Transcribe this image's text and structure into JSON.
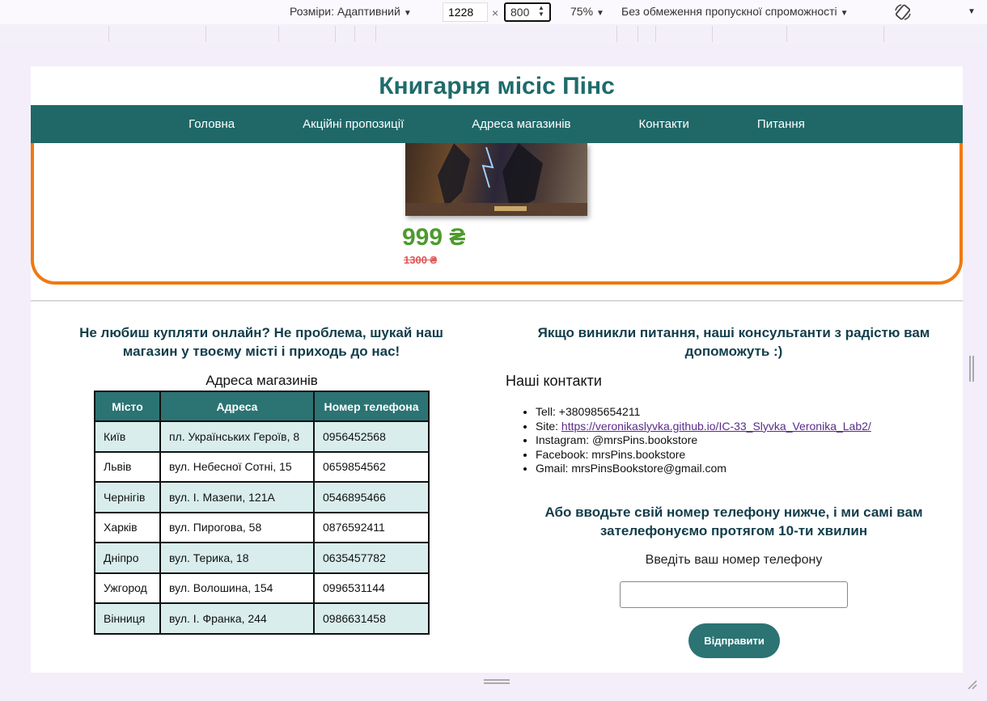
{
  "devtools": {
    "size_label": "Розміри: Адаптивний",
    "width": "1228",
    "height": "800",
    "times": "×",
    "zoom": "75%",
    "throttle": "Без обмеження пропускної спроможності"
  },
  "site": {
    "title": "Книгарня місіс Пінс",
    "nav": [
      "Головна",
      "Акційні пропозиції",
      "Адреса магазинів",
      "Контакти",
      "Питання"
    ]
  },
  "promo": {
    "price_new": "999 ₴",
    "price_old": "1300 ₴"
  },
  "stores": {
    "heading": "Не любиш купляти онлайн? Не проблема, шукай наш магазин у твоєму місті і приходь до нас!",
    "caption": "Адреса магазинів",
    "columns": [
      "Місто",
      "Адреса",
      "Номер телефона"
    ],
    "rows": [
      [
        "Київ",
        "пл. Українських Героїв, 8",
        "0956452568"
      ],
      [
        "Львів",
        "вул. Небесної Сотні, 15",
        "0659854562"
      ],
      [
        "Чернігів",
        "вул. І. Мазепи, 121А",
        "0546895466"
      ],
      [
        "Харків",
        "вул. Пирогова, 58",
        "0876592411"
      ],
      [
        "Дніпро",
        "вул. Терика, 18",
        "0635457782"
      ],
      [
        "Ужгород",
        "вул. Волошина, 154",
        "0996531144"
      ],
      [
        "Вінниця",
        "вул. І. Франка, 244",
        "0986631458"
      ]
    ]
  },
  "contacts": {
    "heading": "Якщо виникли питання, наші консультанти з радістю вам допоможуть :)",
    "title": "Наші контакти",
    "tell": "Tell: +380985654211",
    "site_label": "Site: ",
    "site_link": "https://veronikaslyvka.github.io/IC-33_Slyvka_Veronika_Lab2/",
    "instagram": "Instagram: @mrsPins.bookstore",
    "facebook": "Facebook: mrsPins.bookstore",
    "gmail": "Gmail: mrsPinsBookstore@gmail.com",
    "call_heading": "Або вводьте свій номер телефону нижче, і ми самі вам зателефонуємо протягом 10-ти хвилин",
    "phone_label": "Введіть ваш номер телефону",
    "phone_value": "",
    "send_button": "Відправити"
  }
}
